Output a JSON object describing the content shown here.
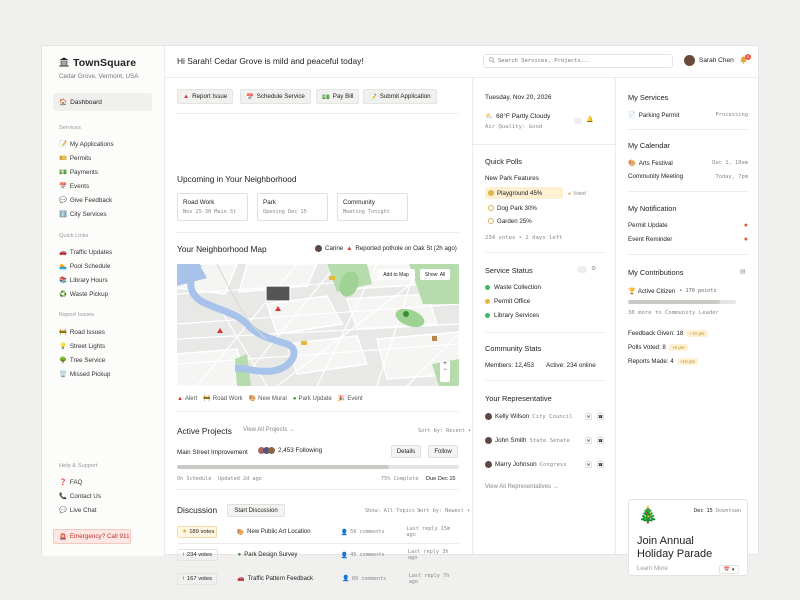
{
  "sidebar": {
    "brand": "TownSquare",
    "location": "Cedar Grove, Vermont, USA",
    "dashboard": "Dashboard",
    "services_title": "Services",
    "services": [
      "My Applications",
      "Permits",
      "Payments",
      "Events",
      "Give Feedback",
      "City Services"
    ],
    "quick_links_title": "Quick Links",
    "quick_links": [
      "Traffic Updates",
      "Pool Schedule",
      "Library Hours",
      "Waste Pickup"
    ],
    "report_title": "Report Issues",
    "report": [
      "Road Issues",
      "Street Lights",
      "Tree Service",
      "Missed Pickup"
    ],
    "help_title": "Help & Support",
    "help": [
      "FAQ",
      "Contact Us",
      "Live Chat"
    ],
    "emergency": "Emergency? Call 911"
  },
  "header": {
    "greeting": "Hi Sarah! Cedar Grove is mild and peaceful today!",
    "search_placeholder": "Search Services, Projects...",
    "user_name": "Sarah Chen",
    "notif_count": "3"
  },
  "quick_actions": [
    "Report Issue",
    "Schedule Service",
    "Pay Bill",
    "Submit Application"
  ],
  "neighborhood": {
    "title": "Upcoming in Your Neighborhood",
    "cards": [
      {
        "title": "Road Work",
        "sub": "Nov 25-30 Main St"
      },
      {
        "title": "Park",
        "sub": "Opening Dec 15"
      },
      {
        "title": "Community",
        "sub": "Meeting Tonight"
      }
    ]
  },
  "map": {
    "title": "Your Neighborhood Map",
    "reporter": "Carine",
    "report_text": "Reported pothole on Oak St (2h ago)",
    "add_to_map": "Add to Map",
    "show_all": "Show: All",
    "zoom_in": "+",
    "zoom_out": "−",
    "legend": [
      "Alert",
      "Road Work",
      "New Mural",
      "Park Update",
      "Event"
    ]
  },
  "projects": {
    "title": "Active Projects",
    "view_all": "View All Projects →",
    "sort": "Sort by: Recent ▾",
    "name": "Main Street Improvement",
    "following": "2,453 Following",
    "details": "Details",
    "follow": "Follow",
    "status": "On Schedule",
    "updated": "Updated 2d ago",
    "complete_label": "75% Complete",
    "progress": 0.75,
    "due": "Due Dec 15"
  },
  "discussion": {
    "title": "Discussion",
    "start": "Start Discussion",
    "filter": "Show: All Topics ▾",
    "sort": "Sort by: Newest ▾",
    "rows": [
      {
        "votes": "189 votes",
        "title": "New Public Art Location",
        "comments": "56 comments",
        "reply": "Last reply 15m ago"
      },
      {
        "votes": "234 votes",
        "title": "Park Design Survey",
        "comments": "45 comments",
        "reply": "Last reply 3h ago"
      },
      {
        "votes": "167 votes",
        "title": "Traffic Pattern Feedback",
        "comments": "89 comments",
        "reply": "Last reply 7h ago"
      }
    ]
  },
  "weather": {
    "date": "Tuesday, Nov 20, 2026",
    "condition": "68°F Partly Cloudy",
    "air": "Air Quality: Good"
  },
  "polls": {
    "title": "Quick Polls",
    "question": "New Park Features",
    "options": [
      "Playground 45%",
      "Dog Park 30%",
      "Garden 25%"
    ],
    "voted": "Voted",
    "meta": "234 votes • 2 days left"
  },
  "service_status": {
    "title": "Service Status",
    "items": [
      {
        "name": "Waste Collection",
        "color": "#3fb867"
      },
      {
        "name": "Permit Office",
        "color": "#e8b83b"
      },
      {
        "name": "Library Services",
        "color": "#3fb867"
      }
    ]
  },
  "stats": {
    "title": "Community Stats",
    "members": "Members: 12,453",
    "active": "Active: 234 online"
  },
  "reps": {
    "title": "Your Representative",
    "items": [
      {
        "name": "Kelly Wilson",
        "role": "City Council"
      },
      {
        "name": "John Smith",
        "role": "State Senate"
      },
      {
        "name": "Marry Johnson",
        "role": "Congress"
      }
    ],
    "view_all": "View All Representatives →"
  },
  "my_services": {
    "title": "My Services",
    "item": "Parking Permit",
    "status": "Processing"
  },
  "calendar": {
    "title": "My Calendar",
    "items": [
      {
        "name": "Arts Festival",
        "date": "Dec 1, 10am"
      },
      {
        "name": "Community Meeting",
        "date": "Today, 7pm"
      }
    ]
  },
  "notifications": {
    "title": "My Notification",
    "items": [
      "Permit Update",
      "Event Reminder"
    ]
  },
  "contributions": {
    "title": "My Contributions",
    "level": "Active Citizen",
    "points": "• 170 points",
    "progress": 0.85,
    "next": "30 more to Community Leader",
    "rows": [
      {
        "label": "Feedback Given: 18",
        "tag": "+10 pts"
      },
      {
        "label": "Polls Voted: 8",
        "tag": "+5 pts"
      },
      {
        "label": "Reports Made: 4",
        "tag": "+15 pts"
      }
    ]
  },
  "event": {
    "date": "Dec 15",
    "place": "Downtown",
    "title": "Join Annual Holiday Parade",
    "learn": "Learn More"
  }
}
